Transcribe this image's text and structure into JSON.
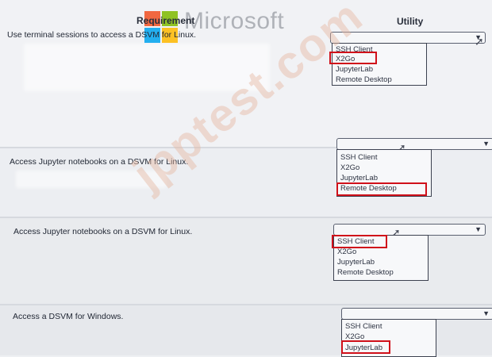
{
  "headers": {
    "requirement": "Requirement",
    "utility": "Utility"
  },
  "logo": {
    "text": "Microsoft"
  },
  "watermark": "jpptest.com",
  "rows": [
    {
      "requirement": "Use terminal sessions to access a DSVM for Linux.",
      "options": [
        "SSH Client",
        "X2Go",
        "JupyterLab",
        "Remote Desktop"
      ],
      "selected": "X2Go"
    },
    {
      "requirement": "Access Jupyter notebooks on a DSVM for Linux.",
      "options": [
        "SSH Client",
        "X2Go",
        "JupyterLab",
        "Remote Desktop"
      ],
      "selected": "Remote Desktop"
    },
    {
      "requirement": "Access Jupyter notebooks on a DSVM for Linux.",
      "options": [
        "SSH Client",
        "X2Go",
        "JupyterLab",
        "Remote Desktop"
      ],
      "selected": "SSH Client"
    },
    {
      "requirement": "Access a DSVM for Windows.",
      "options": [
        "SSH Client",
        "X2Go",
        "JupyterLab"
      ],
      "selected": "JupyterLab"
    }
  ],
  "colors": {
    "highlight": "#d0101a",
    "ms_red": "#f25022",
    "ms_green": "#7fba00",
    "ms_blue": "#00a4ef",
    "ms_yellow": "#ffb900"
  },
  "icons": {
    "caret": "chevron-down-icon",
    "cursor": "mouse-pointer-icon"
  }
}
